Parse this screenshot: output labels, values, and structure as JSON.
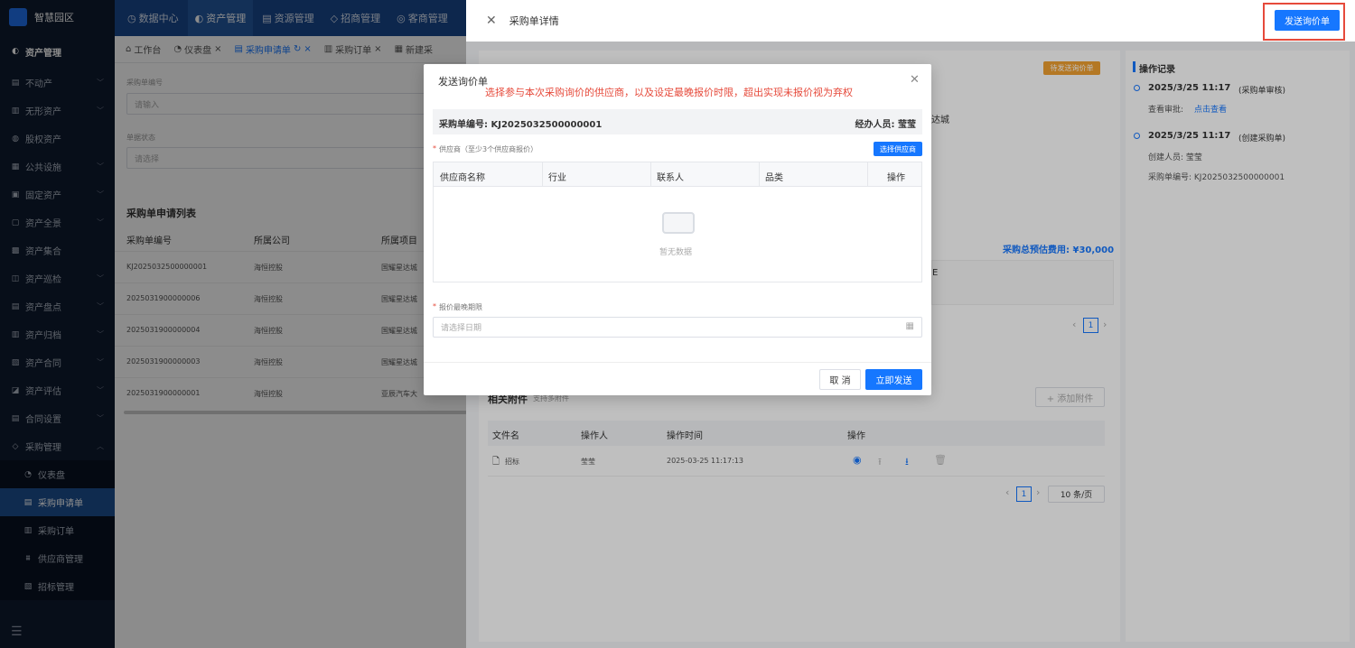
{
  "sidebar": {
    "brand": "智慧园区",
    "section": "资产管理",
    "items": [
      "不动产",
      "无形资产",
      "股权资产",
      "公共设施",
      "固定资产",
      "资产全景",
      "资产集合",
      "资产巡检",
      "资产盘点",
      "资产归档",
      "资产合同",
      "资产评估",
      "合同设置",
      "采购管理"
    ],
    "sub_items": [
      "仪表盘",
      "采购申请单",
      "采购订单",
      "供应商管理",
      "招标管理"
    ]
  },
  "topnav": [
    "数据中心",
    "资产管理",
    "资源管理",
    "招商管理",
    "客商管理"
  ],
  "tabs": [
    "工作台",
    "仪表盘",
    "采购申请单",
    "采购订单",
    "新建采"
  ],
  "filters": {
    "code_label": "采购单编号",
    "code_placeholder": "请输入",
    "status_label": "单据状态",
    "status_placeholder": "请选择"
  },
  "list": {
    "title": "采购单申请列表",
    "headers": [
      "采购单编号",
      "所属公司",
      "所属项目"
    ],
    "rows": [
      [
        "KJ2025032500000001",
        "海恒控股",
        "国耀星达城"
      ],
      [
        "2025031900000006",
        "海恒控股",
        "国耀星达城"
      ],
      [
        "2025031900000004",
        "海恒控股",
        "国耀星达城"
      ],
      [
        "2025031900000003",
        "海恒控股",
        "国耀星达城"
      ],
      [
        "2025031900000001",
        "海恒控股",
        "亚辰汽车大"
      ]
    ]
  },
  "drawer": {
    "title": "采购单详情",
    "send_button": "发送询价单",
    "status_badge": "待发送询价单",
    "partial_city": "达城",
    "total_estimate": "采购总预估费用: ¥30,000",
    "partial_col": "E",
    "page_num": "1",
    "attachments": {
      "title": "相关附件",
      "subtitle": "支持多附件",
      "add_button": "+ 添加附件",
      "headers": [
        "文件名",
        "操作人",
        "操作时间",
        "操作"
      ],
      "row": {
        "name": "招标",
        "operator": "莹莹",
        "time": "2025-03-25 11:17:13"
      },
      "page": "1",
      "page_size": "10 条/页"
    }
  },
  "records": {
    "title": "操作记录",
    "entries": [
      {
        "time": "2025/3/25 11:17",
        "action": "(采购单审核)",
        "line1_label": "查看审批:",
        "line1_link": "点击查看"
      },
      {
        "time": "2025/3/25 11:17",
        "action": "(创建采购单)",
        "line1_label": "创建人员: 莹莹",
        "line2": "采购单编号: KJ2025032500000001"
      }
    ]
  },
  "modal": {
    "title": "发送询价单",
    "annotation": "选择参与本次采购询价的供应商，以及设定最晚报价时限，超出实现未报价视为弃权",
    "code_label": "采购单编号: KJ2025032500000001",
    "handler_label": "经办人员: 莹莹",
    "supplier_label": "供应商（至少3个供应商报价）",
    "select_supplier_button": "选择供应商",
    "table_headers": [
      "供应商名称",
      "行业",
      "联系人",
      "品类",
      "操作"
    ],
    "empty_text": "暂无数据",
    "deadline_label": "报价最晚期限",
    "date_placeholder": "请选择日期",
    "cancel": "取 消",
    "send_now": "立即发送"
  },
  "colors": {
    "primary": "#1677ff",
    "annotation": "#e64a3b",
    "sidebar_bg": "#0e1a2e",
    "topbar_bg": "#19478c"
  }
}
